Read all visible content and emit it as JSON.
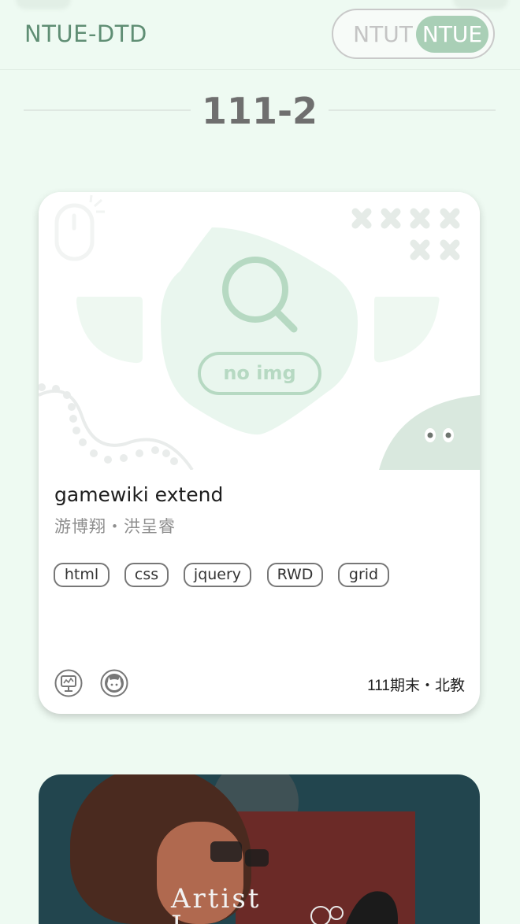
{
  "header": {
    "logo": "NTUE-DTD",
    "toggle": {
      "option_left": "NTUT",
      "option_right": "NTUE",
      "selected": "NTUE"
    }
  },
  "section": {
    "title": "111-2"
  },
  "cards": [
    {
      "image_placeholder": "no img",
      "title": "gamewiki extend",
      "authors": "游博翔・洪呈睿",
      "tags": [
        "html",
        "css",
        "jquery",
        "RWD",
        "grid"
      ],
      "meta": "111期末・北教",
      "icons": [
        "demo-monitor-icon",
        "github-icon"
      ]
    },
    {
      "banner_text_line1": "Artist",
      "banner_text_line2": "J"
    }
  ],
  "colors": {
    "accent": "#a9cfb6",
    "logo": "#5f8e74",
    "background": "#eefaf2"
  }
}
